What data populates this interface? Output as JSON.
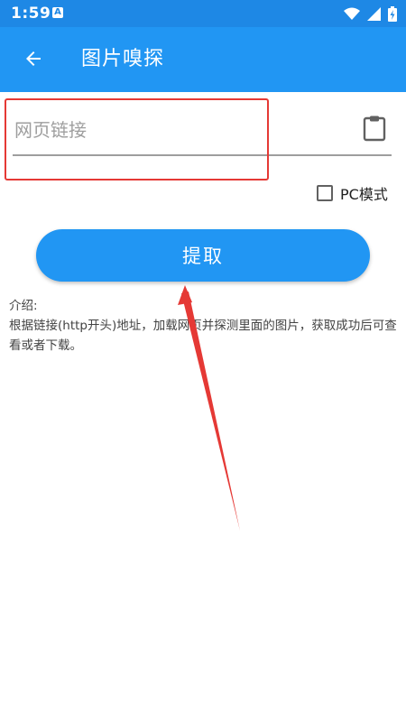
{
  "status_bar": {
    "time": "1:59",
    "app_icon_letter": "A",
    "icons": [
      "wifi-icon",
      "signal-icon",
      "battery-charging-icon"
    ]
  },
  "app_bar": {
    "back_icon": "arrow-left-icon",
    "title": "图片嗅探"
  },
  "url_field": {
    "value": "",
    "placeholder": "网页链接",
    "paste_icon": "clipboard-icon"
  },
  "pc_mode": {
    "label": "PC模式",
    "checked": false
  },
  "extract_button": {
    "label": "提取"
  },
  "intro": {
    "heading": "介绍:",
    "body": "根据链接(http开头)地址，加载网页并探测里面的图片，获取成功后可查看或者下载。"
  },
  "colors": {
    "status_bar": "#1e88e5",
    "app_bar": "#2196f3",
    "button": "#2196f3",
    "annotation": "#e53935"
  }
}
